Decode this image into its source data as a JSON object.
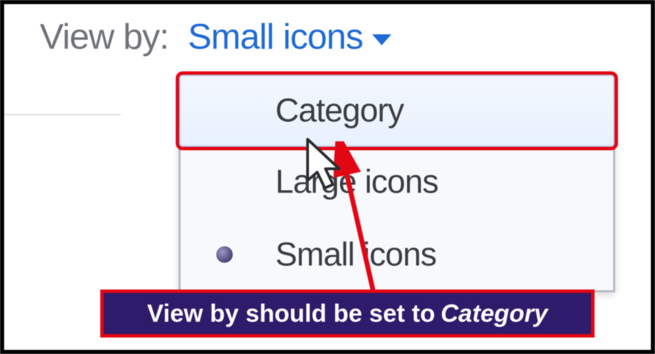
{
  "viewby": {
    "label": "View by:",
    "current": "Small icons",
    "options": [
      "Category",
      "Large icons",
      "Small icons"
    ],
    "selected_index": 2
  },
  "annotation": {
    "text_prefix": "View by should be set to ",
    "text_emph": "Category"
  },
  "colors": {
    "link": "#1f6ad6",
    "highlight": "#e30613",
    "annotation_bg": "#2f1b6b"
  }
}
